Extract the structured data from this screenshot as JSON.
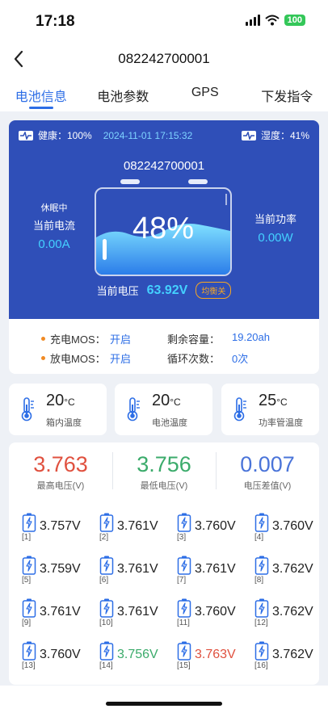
{
  "status_bar": {
    "time": "17:18",
    "battery": "100"
  },
  "nav": {
    "title": "082242700001"
  },
  "tabs": [
    "电池信息",
    "电池参数",
    "GPS",
    "下发指令"
  ],
  "panel": {
    "health": "健康：100%",
    "time": "2024-11-01 17:15:32",
    "humidity": "湿度：41%",
    "device_id": "082242700001",
    "state": "休眠中",
    "current_label": "当前电流",
    "current_value": "0.00A",
    "power_label": "当前功率",
    "power_value": "0.00W",
    "soc": "48%",
    "voltage_label": "当前电压",
    "voltage_value": "63.92V",
    "balance": "均衡关"
  },
  "mos": {
    "charge_label": "充电MOS：",
    "charge_value": "开启",
    "discharge_label": "放电MOS：",
    "discharge_value": "开启",
    "remaining_label": "剩余容量：",
    "remaining_value": "19.20ah",
    "cycles_label": "循环次数：",
    "cycles_value": "0次"
  },
  "temps": [
    {
      "value": "20",
      "unit": "°C",
      "label": "箱内温度"
    },
    {
      "value": "20",
      "unit": "°C",
      "label": "电池温度"
    },
    {
      "value": "25",
      "unit": "°C",
      "label": "功率管温度"
    }
  ],
  "stats": [
    {
      "value": "3.763",
      "label": "最高电压(V)",
      "color": "#e0513f"
    },
    {
      "value": "3.756",
      "label": "最低电压(V)",
      "color": "#3bab6b"
    },
    {
      "value": "0.007",
      "label": "电压差值(V)",
      "color": "#4a74d9"
    }
  ],
  "cells": [
    {
      "idx": "[1]",
      "v": "3.757V",
      "color": "#222222"
    },
    {
      "idx": "[2]",
      "v": "3.761V",
      "color": "#222222"
    },
    {
      "idx": "[3]",
      "v": "3.760V",
      "color": "#222222"
    },
    {
      "idx": "[4]",
      "v": "3.760V",
      "color": "#222222"
    },
    {
      "idx": "[5]",
      "v": "3.759V",
      "color": "#222222"
    },
    {
      "idx": "[6]",
      "v": "3.761V",
      "color": "#222222"
    },
    {
      "idx": "[7]",
      "v": "3.761V",
      "color": "#222222"
    },
    {
      "idx": "[8]",
      "v": "3.762V",
      "color": "#222222"
    },
    {
      "idx": "[9]",
      "v": "3.761V",
      "color": "#222222"
    },
    {
      "idx": "[10]",
      "v": "3.761V",
      "color": "#222222"
    },
    {
      "idx": "[11]",
      "v": "3.760V",
      "color": "#222222"
    },
    {
      "idx": "[12]",
      "v": "3.762V",
      "color": "#222222"
    },
    {
      "idx": "[13]",
      "v": "3.760V",
      "color": "#222222"
    },
    {
      "idx": "[14]",
      "v": "3.756V",
      "color": "#3bab6b"
    },
    {
      "idx": "[15]",
      "v": "3.763V",
      "color": "#e0513f"
    },
    {
      "idx": "[16]",
      "v": "3.762V",
      "color": "#222222"
    }
  ],
  "colors": {
    "accent": "#2d6ee6",
    "panel": "#2f4fb8",
    "cyan": "#44d1ff"
  }
}
